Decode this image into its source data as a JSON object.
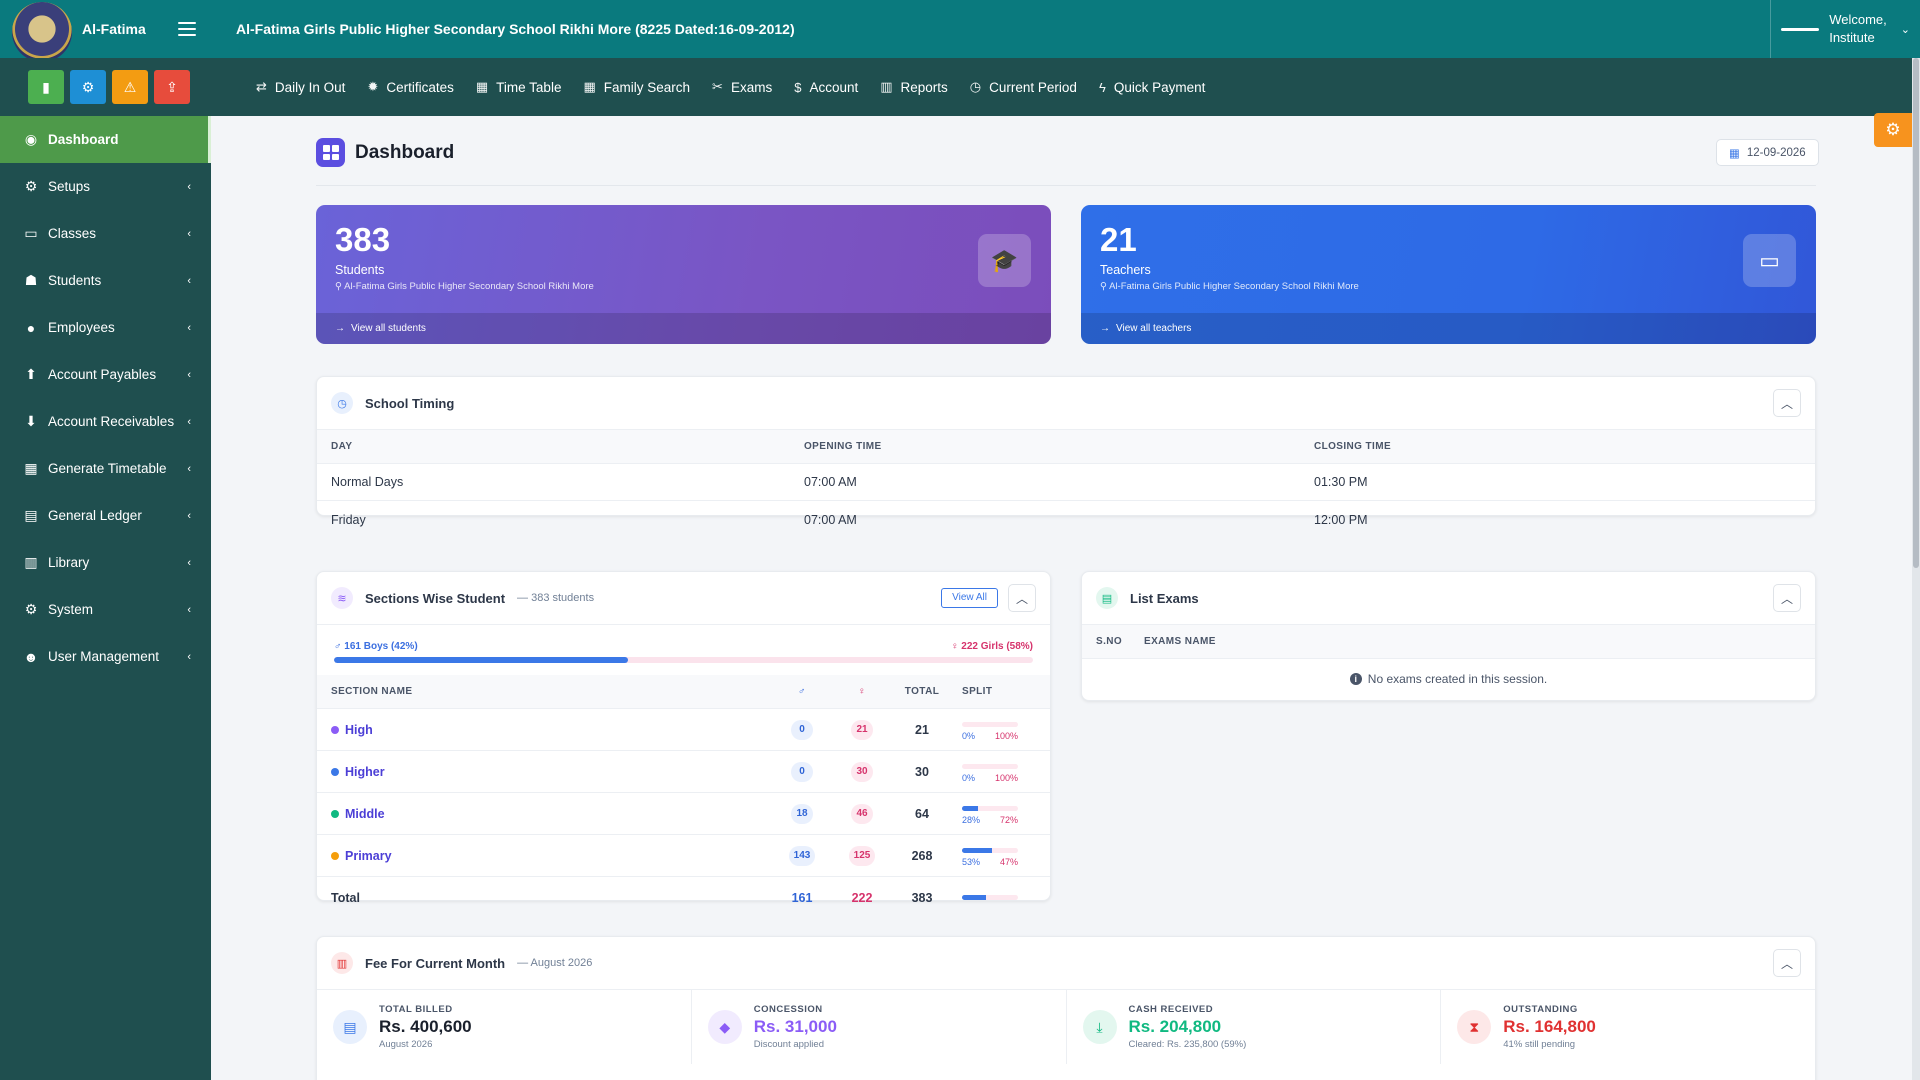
{
  "brand": {
    "name": "Al-Fatima"
  },
  "header": {
    "school_title": "Al-Fatima Girls Public Higher Secondary School Rikhi More (8225 Dated:16-09-2012)",
    "welcome_line1": "Welcome,",
    "welcome_line2": "Institute"
  },
  "quick_buttons": [
    {
      "icon": "signal-bars-icon",
      "color": "#4caf50"
    },
    {
      "icon": "cogs-icon",
      "color": "#1e8fd5"
    },
    {
      "icon": "warning-icon",
      "color": "#f39c12"
    },
    {
      "icon": "upload-icon",
      "color": "#e74c3c"
    }
  ],
  "topnav": [
    {
      "label": "Daily In Out",
      "icon": "exchange-icon"
    },
    {
      "label": "Certificates",
      "icon": "certificate-icon"
    },
    {
      "label": "Time Table",
      "icon": "calendar-icon"
    },
    {
      "label": "Family Search",
      "icon": "calendar-icon"
    },
    {
      "label": "Exams",
      "icon": "tools-icon"
    },
    {
      "label": "Account",
      "icon": "dollar-icon"
    },
    {
      "label": "Reports",
      "icon": "chart-icon"
    },
    {
      "label": "Current Period",
      "icon": "clock-icon"
    },
    {
      "label": "Quick Payment",
      "icon": "bolt-icon"
    }
  ],
  "sidebar": {
    "items": [
      {
        "label": "Dashboard",
        "icon": "dashboard-icon",
        "active": true
      },
      {
        "label": "Setups",
        "icon": "cogs-icon"
      },
      {
        "label": "Classes",
        "icon": "laptop-icon"
      },
      {
        "label": "Students",
        "icon": "student-icon"
      },
      {
        "label": "Employees",
        "icon": "user-icon"
      },
      {
        "label": "Account Payables",
        "icon": "arrow-up-circle-icon"
      },
      {
        "label": "Account Receivables",
        "icon": "arrow-down-circle-icon"
      },
      {
        "label": "Generate Timetable",
        "icon": "calendar-icon"
      },
      {
        "label": "General Ledger",
        "icon": "book-icon"
      },
      {
        "label": "Library",
        "icon": "library-icon"
      },
      {
        "label": "System",
        "icon": "gear-icon"
      },
      {
        "label": "User Management",
        "icon": "users-icon"
      }
    ]
  },
  "page": {
    "title": "Dashboard",
    "date": "12-09-2026"
  },
  "stats": [
    {
      "value": "383",
      "label": "Students",
      "location": "Al-Fatima Girls Public Higher Secondary School Rikhi More",
      "link": "View all students",
      "icon": "graduate-icon"
    },
    {
      "value": "21",
      "label": "Teachers",
      "location": "Al-Fatima Girls Public Higher Secondary School Rikhi More",
      "link": "View all teachers",
      "icon": "chalkboard-teacher-icon"
    }
  ],
  "timing": {
    "title": "School Timing",
    "columns": [
      "DAY",
      "OPENING TIME",
      "CLOSING TIME"
    ],
    "rows": [
      [
        "Normal Days",
        "07:00 AM",
        "01:30 PM"
      ],
      [
        "Friday",
        "07:00 AM",
        "12:00 PM"
      ]
    ]
  },
  "sections": {
    "title": "Sections Wise Student",
    "subtitle": "— 383 students",
    "view_all": "View All",
    "boys_label": "♂ 161 Boys (42%)",
    "girls_label": "♀ 222 Girls (58%)",
    "boys_fraction": 0.42,
    "columns": [
      "SECTION NAME",
      "♂",
      "♀",
      "TOTAL",
      "SPLIT"
    ],
    "rows": [
      {
        "name": "High",
        "color": "#8b5cf6",
        "boys": "0",
        "girls": "21",
        "total": "21",
        "boys_pct": "0%",
        "girls_pct": "100%",
        "boys_frac": 0
      },
      {
        "name": "Higher",
        "color": "#3b78e7",
        "boys": "0",
        "girls": "30",
        "total": "30",
        "boys_pct": "0%",
        "girls_pct": "100%",
        "boys_frac": 0
      },
      {
        "name": "Middle",
        "color": "#10b981",
        "boys": "18",
        "girls": "46",
        "total": "64",
        "boys_pct": "28%",
        "girls_pct": "72%",
        "boys_frac": 0.28
      },
      {
        "name": "Primary",
        "color": "#f59e0b",
        "boys": "143",
        "girls": "125",
        "total": "268",
        "boys_pct": "53%",
        "girls_pct": "47%",
        "boys_frac": 0.53
      }
    ],
    "total": {
      "label": "Total",
      "boys": "161",
      "girls": "222",
      "total": "383",
      "boys_frac": 0.42
    }
  },
  "exams": {
    "title": "List Exams",
    "columns": [
      "S.NO",
      "EXAMS NAME"
    ],
    "empty": "No exams created in this session."
  },
  "fee": {
    "title": "Fee For Current Month",
    "subtitle": "— August 2026",
    "cells": [
      {
        "label": "TOTAL BILLED",
        "value": "Rs. 400,600",
        "note": "August 2026",
        "color": "#1a202c",
        "icon": "invoice-icon",
        "icon_bg": "#e8f0fd",
        "icon_color": "#3b78e7"
      },
      {
        "label": "CONCESSION",
        "value": "Rs. 31,000",
        "note": "Discount applied",
        "color": "#8b5cf6",
        "icon": "tag-icon",
        "icon_bg": "#f1ebfe",
        "icon_color": "#8b5cf6"
      },
      {
        "label": "CASH RECEIVED",
        "value": "Rs. 204,800",
        "note": "Cleared: Rs. 235,800 (59%)",
        "color": "#10b981",
        "icon": "hand-money-icon",
        "icon_bg": "#e3f7ef",
        "icon_color": "#10b981"
      },
      {
        "label": "OUTSTANDING",
        "value": "Rs. 164,800",
        "note": "41% still pending",
        "color": "#e03131",
        "icon": "hourglass-icon",
        "icon_bg": "#fde8e8",
        "icon_color": "#e03131"
      }
    ]
  }
}
